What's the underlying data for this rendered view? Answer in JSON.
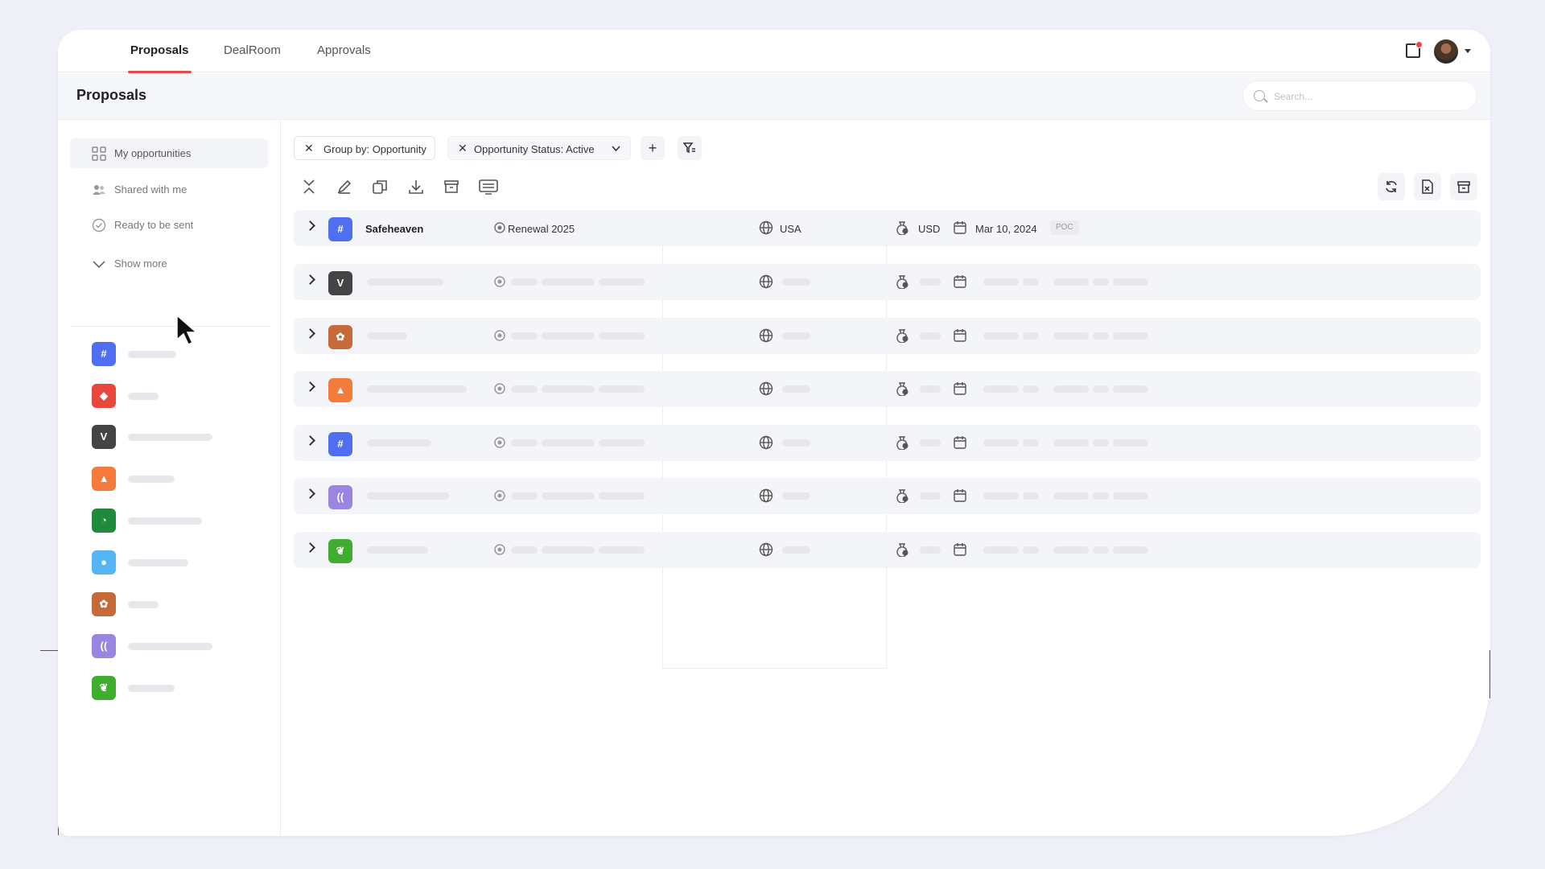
{
  "nav": {
    "tabs": [
      {
        "label": "Proposals",
        "active": true
      },
      {
        "label": "DealRoom",
        "active": false
      },
      {
        "label": "Approvals",
        "active": false
      }
    ],
    "notification_icon": "notification-icon",
    "avatar": "user-avatar"
  },
  "header": {
    "title": "Proposals",
    "search_placeholder": "Search..."
  },
  "sidebar": {
    "items": [
      {
        "label": "My opportunities",
        "icon": "grid-icon",
        "active": true
      },
      {
        "label": "Shared with me",
        "icon": "users-icon",
        "active": false
      },
      {
        "label": "Ready to be sent",
        "icon": "check-circle-icon",
        "active": false
      },
      {
        "label": "Show more",
        "icon": "chevron-down-icon",
        "active": false
      }
    ],
    "apps": [
      {
        "icon": "grid-logo",
        "color": "#4f6ef0"
      },
      {
        "icon": "gem-logo",
        "color": "#e8473e"
      },
      {
        "icon": "v-logo",
        "color": "#444444",
        "letter": "V"
      },
      {
        "icon": "triangle-logo",
        "color": "#f47b3c"
      },
      {
        "icon": "chart-logo",
        "color": "#1f8a3c"
      },
      {
        "icon": "blob-logo",
        "color": "#56b5f5"
      },
      {
        "icon": "lotus-logo",
        "color": "#c66a3a"
      },
      {
        "icon": "waves-logo",
        "color": "#9a86e0"
      },
      {
        "icon": "leaf-logo",
        "color": "#3fae2e"
      }
    ]
  },
  "toolbar": {
    "filters": [
      {
        "label": "Group by: Opportunity"
      },
      {
        "label": "Opportunity Status: Active"
      }
    ],
    "add_icon": "plus-icon",
    "filter_icon": "filter-icon",
    "tools": [
      "collapse-icon",
      "edit-icon",
      "copy-icon",
      "download-icon",
      "archive-icon",
      "present-icon"
    ],
    "right_tools": [
      "refresh-icon",
      "export-excel-icon",
      "archive-box-icon"
    ]
  },
  "rows": [
    {
      "name": "Safeheaven",
      "status": "Renewal 2025",
      "country": "USA",
      "currency": "USD",
      "date": "Mar 10, 2024",
      "tag": "POC",
      "color": "#4f6ef0",
      "logo": "grid-logo"
    },
    {
      "color": "#444444",
      "logo": "v-logo",
      "letter": "V"
    },
    {
      "color": "#c66a3a",
      "logo": "lotus-logo"
    },
    {
      "color": "#f47b3c",
      "logo": "triangle-logo"
    },
    {
      "color": "#4f6ef0",
      "logo": "grid-logo"
    },
    {
      "color": "#9a86e0",
      "logo": "waves-logo"
    },
    {
      "color": "#3fae2e",
      "logo": "leaf-logo"
    }
  ]
}
